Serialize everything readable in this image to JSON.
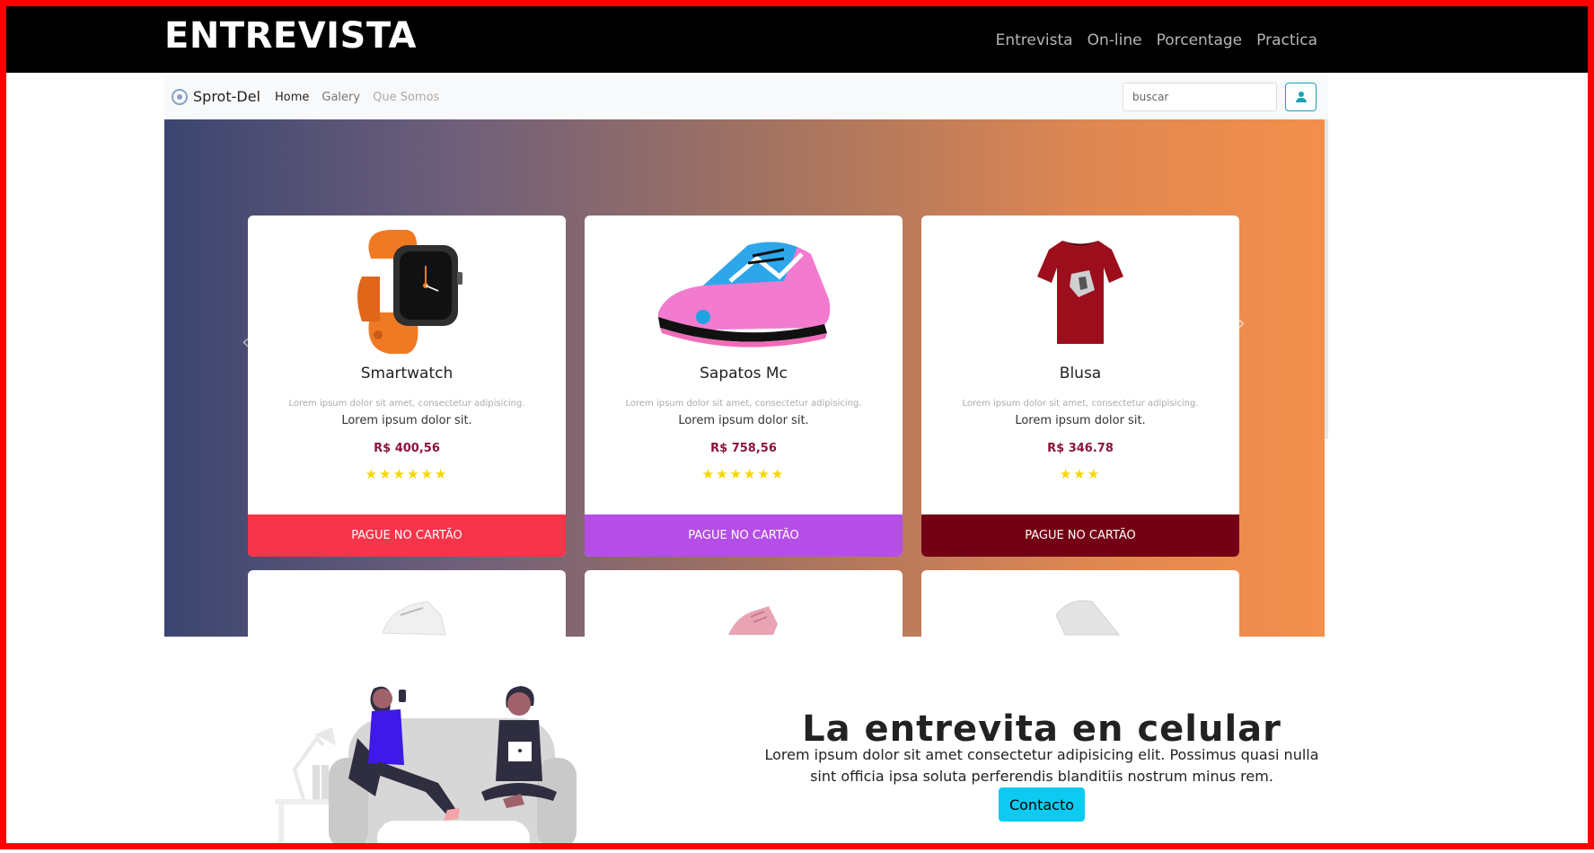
{
  "topbar": {
    "brand": "ENTREVISTA",
    "links": [
      "Entrevista",
      "On-line",
      "Porcentage",
      "Practica"
    ]
  },
  "inner_nav": {
    "brand": "Sprot-Del",
    "links": [
      "Home",
      "Galery",
      "Que Somos"
    ],
    "search_placeholder": "buscar"
  },
  "products": [
    {
      "title": "Smartwatch",
      "desc": "Lorem ipsum dolor sit amet, consectetur adipisicing.",
      "sub": "Lorem ipsum dolor sit.",
      "price": "R$ 400,56",
      "stars": "★★★★★★",
      "button": "PAGUE NO CARTÃO",
      "button_color": "#f8344a"
    },
    {
      "title": "Sapatos Mc",
      "desc": "Lorem ipsum dolor sit amet, consectetur adipisicing.",
      "sub": "Lorem ipsum dolor sit.",
      "price": "R$ 758,56",
      "stars": "★★★★★★",
      "button": "PAGUE NO CARTÃO",
      "button_color": "#b54ee6"
    },
    {
      "title": "Blusa",
      "desc": "Lorem ipsum dolor sit amet, consectetur adipisicing.",
      "sub": "Lorem ipsum dolor sit.",
      "price": "R$ 346.78",
      "stars": "★★★",
      "button": "PAGUE NO CARTÃO",
      "button_color": "#730014"
    }
  ],
  "promo": {
    "title": "La entrevita en celular",
    "text": "Lorem ipsum dolor sit amet consectetur adipisicing elit. Possimus quasi nulla sint officia ipsa soluta perferendis blanditiis nostrum minus rem.",
    "button": "Contacto"
  },
  "icons": {
    "logo": "target-logo-icon",
    "user": "user-icon",
    "prev": "chevron-left-icon",
    "next": "chevron-right-icon"
  },
  "colors": {
    "frame": "#ff0000",
    "topbar": "#000000",
    "accent": "#0dcaf0",
    "gradient_start": "#3b4570",
    "gradient_end": "#f38f4b"
  }
}
